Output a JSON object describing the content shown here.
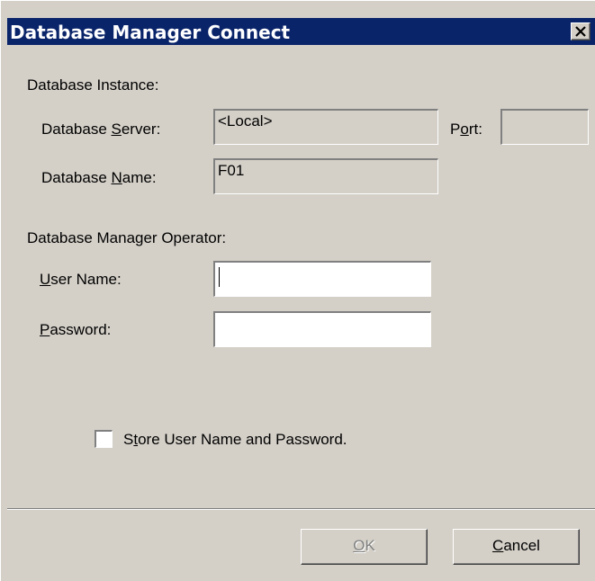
{
  "window": {
    "title": "Database Manager Connect"
  },
  "instance": {
    "group_label": "Database Instance:",
    "server_label_pre": "Database ",
    "server_label_key": "S",
    "server_label_post": "erver:",
    "server_value": "<Local>",
    "port_label_pre": "P",
    "port_label_key": "o",
    "port_label_post": "rt:",
    "port_value": "",
    "name_label_pre": "Database ",
    "name_label_key": "N",
    "name_label_post": "ame:",
    "name_value": "F01"
  },
  "operator": {
    "group_label": "Database Manager Operator:",
    "user_label_key": "U",
    "user_label_post": "ser Name:",
    "user_value": "",
    "password_label_key": "P",
    "password_label_post": "assword:",
    "password_value": ""
  },
  "store": {
    "label_pre": "S",
    "label_key": "t",
    "label_post": "ore User Name and Password.",
    "checked": false
  },
  "buttons": {
    "ok_key": "O",
    "ok_post": "K",
    "ok_enabled": false,
    "cancel_key": "C",
    "cancel_post": "ancel"
  },
  "colors": {
    "titlebar": "#0a246a",
    "dialog_bg": "#d4d0c8"
  },
  "icons": {
    "close": "close-icon"
  }
}
